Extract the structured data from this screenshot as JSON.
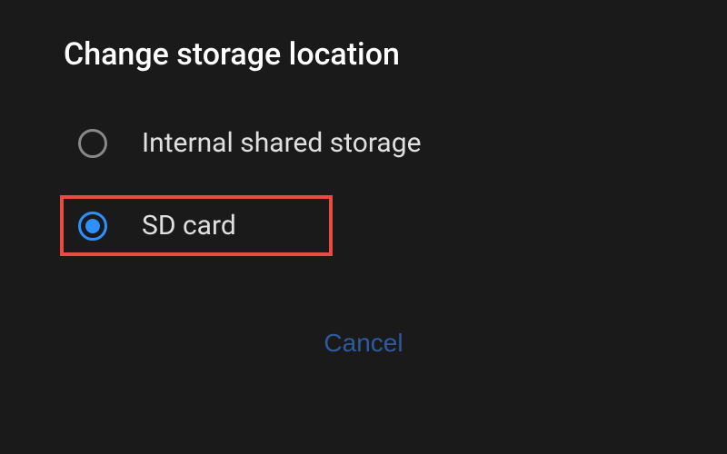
{
  "dialog": {
    "title": "Change storage location",
    "options": [
      {
        "label": "Internal shared storage",
        "selected": false,
        "highlighted": false
      },
      {
        "label": "SD card",
        "selected": true,
        "highlighted": true
      }
    ],
    "cancel_label": "Cancel"
  },
  "colors": {
    "background": "#1a1a1a",
    "accent": "#2e8fff",
    "highlight_border": "#e74c3c",
    "cancel_text": "#2e5a9e"
  }
}
